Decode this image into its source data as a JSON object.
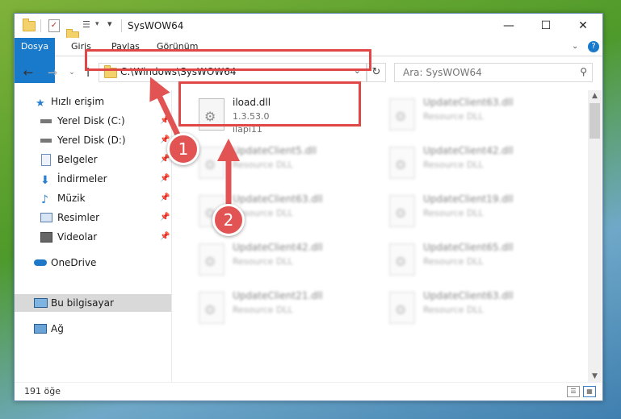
{
  "window": {
    "title": "SysWOW64"
  },
  "ribbon": {
    "tabs": [
      "Dosya",
      "Giriş",
      "Paylaş",
      "Görünüm"
    ]
  },
  "address": {
    "path": "C:\\Windows\\SysWOW64",
    "search_placeholder": "Ara: SysWOW64"
  },
  "sidebar": {
    "items": [
      {
        "label": "Hızlı erişim",
        "icon": "star-icon"
      },
      {
        "label": "Yerel Disk (C:)",
        "icon": "drive-icon"
      },
      {
        "label": "Yerel Disk (D:)",
        "icon": "drive-icon"
      },
      {
        "label": "Belgeler",
        "icon": "documents-icon"
      },
      {
        "label": "İndirmeler",
        "icon": "download-icon"
      },
      {
        "label": "Müzik",
        "icon": "music-icon"
      },
      {
        "label": "Resimler",
        "icon": "pictures-icon"
      },
      {
        "label": "Videolar",
        "icon": "video-icon"
      },
      {
        "label": "OneDrive",
        "icon": "cloud-icon"
      },
      {
        "label": "Bu bilgisayar",
        "icon": "computer-icon"
      },
      {
        "label": "Ağ",
        "icon": "network-icon"
      }
    ],
    "selected": "Bu bilgisayar"
  },
  "files": [
    {
      "name": "iload.dll",
      "line2": "1.3.53.0",
      "line3": "ilapi11",
      "highlight": true
    },
    {
      "name": "UpdateClient63.dll",
      "line2": "Resource DLL"
    },
    {
      "name": "UpdateClient5.dll",
      "line2": "Resource DLL"
    },
    {
      "name": "UpdateClient42.dll",
      "line2": "Resource DLL"
    },
    {
      "name": "UpdateClient63.dll",
      "line2": "Resource DLL"
    },
    {
      "name": "UpdateClient19.dll",
      "line2": "Resource DLL"
    },
    {
      "name": "UpdateClient42.dll",
      "line2": "Resource DLL"
    },
    {
      "name": "UpdateClient65.dll",
      "line2": "Resource DLL"
    },
    {
      "name": "UpdateClient21.dll",
      "line2": "Resource DLL"
    },
    {
      "name": "UpdateClient63.dll",
      "line2": "Resource DLL"
    }
  ],
  "status": {
    "count": "191 öğe"
  },
  "annotations": {
    "badge1": "1",
    "badge2": "2",
    "color": "#e25353"
  }
}
